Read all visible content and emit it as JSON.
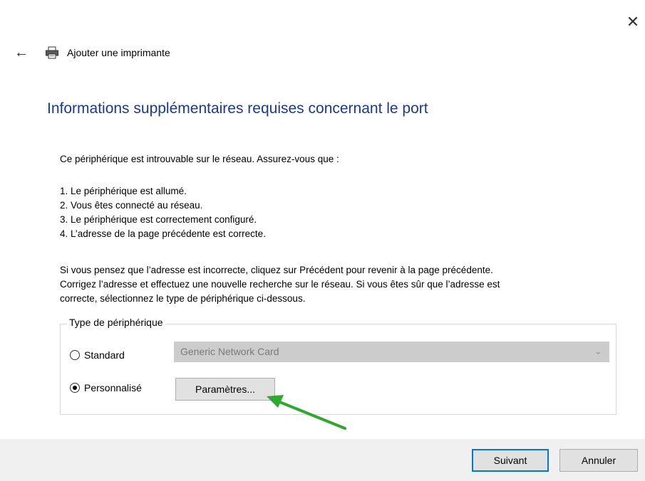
{
  "window": {
    "title": "Ajouter une imprimante",
    "close_symbol": "✕"
  },
  "heading": "Informations supplémentaires requises concernant le port",
  "intro": "Ce périphérique est introuvable sur le réseau. Assurez-vous que :",
  "checklist": [
    "1. Le périphérique est allumé.",
    "2. Vous êtes connecté au réseau.",
    "3. Le périphérique est correctement configuré.",
    "4. L’adresse de la page précédente est correcte."
  ],
  "paragraph": [
    "Si vous pensez que l’adresse est incorrecte, cliquez sur Précédent pour revenir à la page précédente.",
    "Corrigez l’adresse et effectuez une nouvelle recherche sur le réseau. Si vous êtes sûr que l’adresse est",
    "correcte, sélectionnez le type de périphérique ci-dessous."
  ],
  "device_type": {
    "legend": "Type de périphérique",
    "standard_label": "Standard",
    "standard_selected": false,
    "standard_value": "Generic Network Card",
    "custom_label": "Personnalisé",
    "custom_selected": true,
    "params_button": "Paramètres..."
  },
  "footer": {
    "next_button": "Suivant",
    "cancel_button": "Annuler"
  },
  "annotation": {
    "arrow_color": "#2fa82f"
  },
  "icons": {
    "back": "back-arrow-icon",
    "printer": "printer-icon",
    "close": "close-icon",
    "chevron": "chevron-down-icon"
  }
}
